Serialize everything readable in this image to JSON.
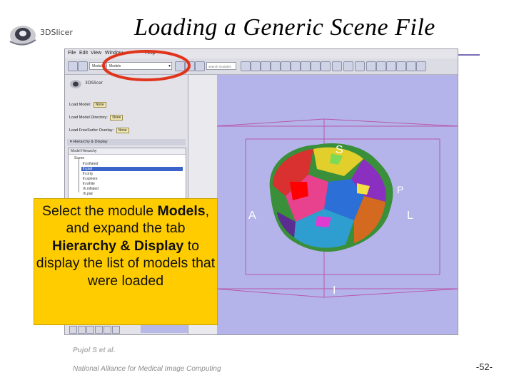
{
  "slide": {
    "title": "Loading a Generic Scene File",
    "logo_text": "3DSlicer",
    "footer_author": "Pujol S et al.",
    "footer_org": "National Alliance for Medical Image Computing",
    "page_number": "-52-",
    "accent_color": "#7b6db8"
  },
  "callout": {
    "text_1": "Select the module ",
    "bold_1": "Models",
    "text_2": ", and expand the tab ",
    "bold_2": "Hierarchy & Display",
    "text_3": " to display the list of models that were loaded",
    "color": "#ffcc00"
  },
  "app": {
    "menu": [
      "File",
      "Edit",
      "View",
      "Window",
      "Help"
    ],
    "toolbar": {
      "module_label": "Modules:",
      "module_value": "Models",
      "search_placeholder": "search modules"
    },
    "panel": {
      "logo_text": "3DSlicer",
      "load_model_label": "Load Model:",
      "load_model_dir_label": "Load Model Directory:",
      "load_freesurfer_label": "Load FreeSurfer Overlay:",
      "none_label": "None",
      "section_title": "Hierarchy & Display",
      "tree_header": "Model Hierarchy",
      "tree_root": "Scene",
      "tree_items": [
        "lh.inflated",
        "lh.pial",
        "lh.orig",
        "lh.sphere",
        "lh.white",
        "rh.inflated",
        "rh.pial"
      ],
      "selected_index": 1
    },
    "viewer": {
      "axis_superior": "S",
      "axis_inferior": "I",
      "axis_anterior": "A",
      "axis_left": "L",
      "axis_posterior": "P",
      "background_color": "#b4b4ea",
      "box_color": "#b84aa0"
    },
    "highlight_color": "#e0351c"
  }
}
